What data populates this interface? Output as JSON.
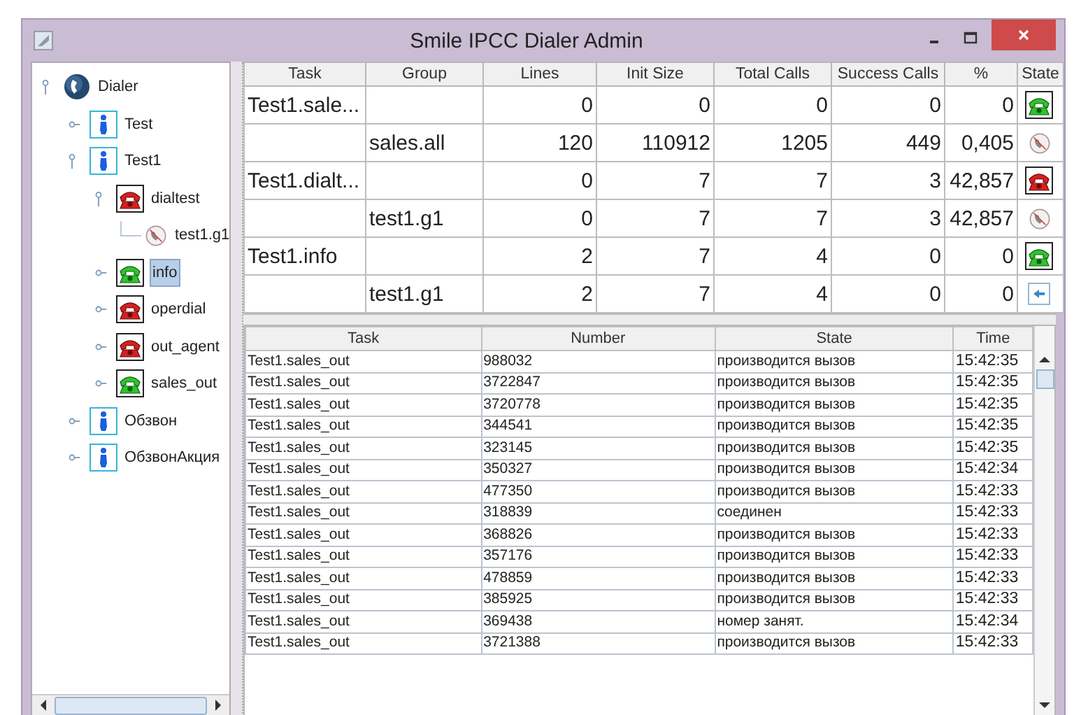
{
  "window": {
    "title": "Smile IPCC Dialer Admin"
  },
  "tree": [
    {
      "label": "Dialer",
      "kind": "dialer",
      "expanded": true,
      "selected": false,
      "children": [
        {
          "label": "Test",
          "kind": "group",
          "expanded": false,
          "selected": false
        },
        {
          "label": "Test1",
          "kind": "group",
          "expanded": true,
          "selected": false,
          "children": [
            {
              "label": "dialtest",
              "kind": "task_stopped",
              "expanded": true,
              "selected": false,
              "children": [
                {
                  "label": "test1.g1",
                  "kind": "line",
                  "selected": false
                }
              ]
            },
            {
              "label": "info",
              "kind": "task_running",
              "expanded": false,
              "selected": true
            },
            {
              "label": "operdial",
              "kind": "task_stopped",
              "expanded": false,
              "selected": false
            },
            {
              "label": "out_agent",
              "kind": "task_stopped",
              "expanded": false,
              "selected": false
            },
            {
              "label": "sales_out",
              "kind": "task_running",
              "expanded": false,
              "selected": false
            }
          ]
        },
        {
          "label": "Обзвон",
          "kind": "group",
          "expanded": false,
          "selected": false
        },
        {
          "label": "ОбзвонАкция",
          "kind": "group",
          "expanded": false,
          "selected": false
        }
      ]
    }
  ],
  "tasks_table": {
    "columns": [
      "Task",
      "Group",
      "Lines",
      "Init Size",
      "Total Calls",
      "Success Calls",
      "%",
      "State"
    ],
    "rows": [
      {
        "task": "Test1.sale...",
        "group": "",
        "lines": "0",
        "init_size": "0",
        "total_calls": "0",
        "success_calls": "0",
        "percent": "0",
        "kind": "running"
      },
      {
        "task": "",
        "group": "sales.all",
        "lines": "120",
        "init_size": "110912",
        "total_calls": "1205",
        "success_calls": "449",
        "percent": "0,405",
        "kind": "line"
      },
      {
        "task": "Test1.dialt...",
        "group": "",
        "lines": "0",
        "init_size": "7",
        "total_calls": "7",
        "success_calls": "3",
        "percent": "42,857",
        "kind": "stopped"
      },
      {
        "task": "",
        "group": "test1.g1",
        "lines": "0",
        "init_size": "7",
        "total_calls": "7",
        "success_calls": "3",
        "percent": "42,857",
        "kind": "line"
      },
      {
        "task": "Test1.info",
        "group": "",
        "lines": "2",
        "init_size": "7",
        "total_calls": "4",
        "success_calls": "0",
        "percent": "0",
        "kind": "running"
      },
      {
        "task": "",
        "group": "test1.g1",
        "lines": "2",
        "init_size": "7",
        "total_calls": "4",
        "success_calls": "0",
        "percent": "0",
        "kind": "back"
      }
    ]
  },
  "calls_table": {
    "columns": [
      "Task",
      "Number",
      "State",
      "Time"
    ],
    "rows": [
      {
        "task": "Test1.sales_out",
        "number": "988032",
        "state": "производится вызов",
        "time": "15:42:35"
      },
      {
        "task": "Test1.sales_out",
        "number": "3722847",
        "state": "производится вызов",
        "time": "15:42:35"
      },
      {
        "task": "Test1.sales_out",
        "number": "3720778",
        "state": "производится вызов",
        "time": "15:42:35"
      },
      {
        "task": "Test1.sales_out",
        "number": "344541",
        "state": "производится вызов",
        "time": "15:42:35"
      },
      {
        "task": "Test1.sales_out",
        "number": "323145",
        "state": "производится вызов",
        "time": "15:42:35"
      },
      {
        "task": "Test1.sales_out",
        "number": "350327",
        "state": "производится вызов",
        "time": "15:42:34"
      },
      {
        "task": "Test1.sales_out",
        "number": "477350",
        "state": "производится вызов",
        "time": "15:42:33"
      },
      {
        "task": "Test1.sales_out",
        "number": "318839",
        "state": "соединен",
        "time": "15:42:33"
      },
      {
        "task": "Test1.sales_out",
        "number": "368826",
        "state": "производится вызов",
        "time": "15:42:33"
      },
      {
        "task": "Test1.sales_out",
        "number": "357176",
        "state": "производится вызов",
        "time": "15:42:33"
      },
      {
        "task": "Test1.sales_out",
        "number": "478859",
        "state": "производится вызов",
        "time": "15:42:33"
      },
      {
        "task": "Test1.sales_out",
        "number": "385925",
        "state": "производится вызов",
        "time": "15:42:33"
      },
      {
        "task": "Test1.sales_out",
        "number": "369438",
        "state": "номер занят.",
        "time": "15:42:34"
      },
      {
        "task": "Test1.sales_out",
        "number": "3721388",
        "state": "производится вызов",
        "time": "15:42:33"
      }
    ]
  }
}
